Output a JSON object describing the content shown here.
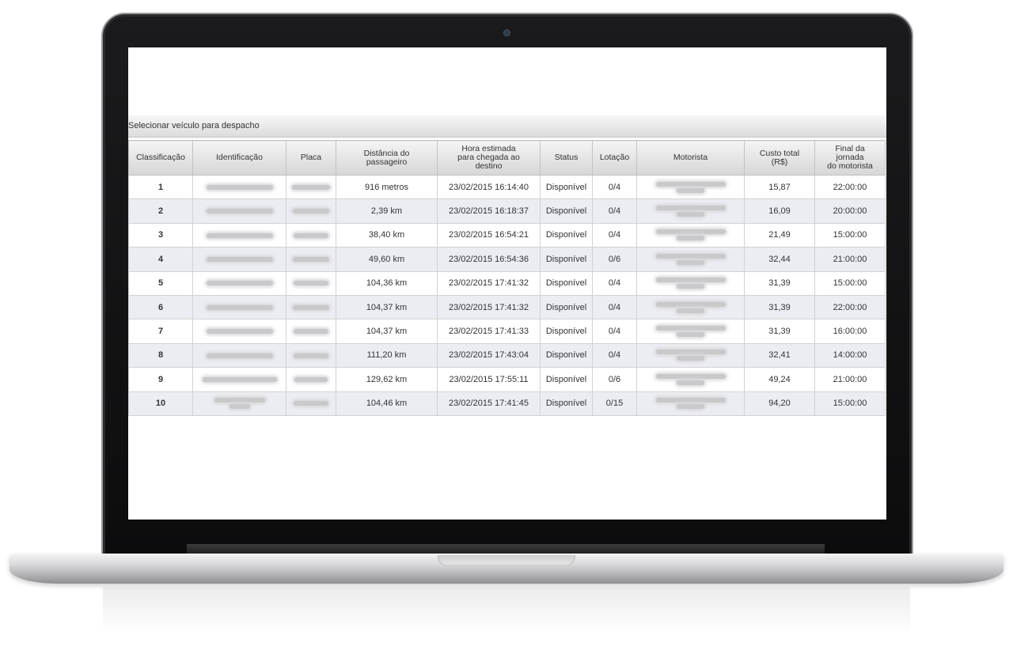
{
  "panel": {
    "title": "Selecionar veículo para despacho"
  },
  "table": {
    "headers": [
      "Classificação",
      "Identificação",
      "Placa",
      "Distância do\npassageiro",
      "Hora estimada\npara chegada ao\ndestino",
      "Status",
      "Lotação",
      "Motorista",
      "Custo total\n(R$)",
      "Final da\njornada\ndo motorista"
    ],
    "rows": [
      {
        "rank": "1",
        "distance": "916 metros",
        "eta": "23/02/2015 16:14:40",
        "status": "Disponível",
        "occupancy": "0/4",
        "cost": "15,87",
        "shift_end": "22:00:00"
      },
      {
        "rank": "2",
        "distance": "2,39 km",
        "eta": "23/02/2015 16:18:37",
        "status": "Disponível",
        "occupancy": "0/4",
        "cost": "16,09",
        "shift_end": "20:00:00"
      },
      {
        "rank": "3",
        "distance": "38,40 km",
        "eta": "23/02/2015 16:54:21",
        "status": "Disponível",
        "occupancy": "0/4",
        "cost": "21,49",
        "shift_end": "15:00:00"
      },
      {
        "rank": "4",
        "distance": "49,60 km",
        "eta": "23/02/2015 16:54:36",
        "status": "Disponível",
        "occupancy": "0/6",
        "cost": "32,44",
        "shift_end": "21:00:00"
      },
      {
        "rank": "5",
        "distance": "104,36 km",
        "eta": "23/02/2015 17:41:32",
        "status": "Disponível",
        "occupancy": "0/4",
        "cost": "31,39",
        "shift_end": "15:00:00"
      },
      {
        "rank": "6",
        "distance": "104,37 km",
        "eta": "23/02/2015 17:41:32",
        "status": "Disponível",
        "occupancy": "0/4",
        "cost": "31,39",
        "shift_end": "22:00:00"
      },
      {
        "rank": "7",
        "distance": "104,37 km",
        "eta": "23/02/2015 17:41:33",
        "status": "Disponível",
        "occupancy": "0/4",
        "cost": "31,39",
        "shift_end": "16:00:00"
      },
      {
        "rank": "8",
        "distance": "111,20 km",
        "eta": "23/02/2015 17:43:04",
        "status": "Disponível",
        "occupancy": "0/4",
        "cost": "32,41",
        "shift_end": "14:00:00"
      },
      {
        "rank": "9",
        "distance": "129,62 km",
        "eta": "23/02/2015 17:55:11",
        "status": "Disponível",
        "occupancy": "0/6",
        "cost": "49,24",
        "shift_end": "21:00:00"
      },
      {
        "rank": "10",
        "distance": "104,46 km",
        "eta": "23/02/2015 17:41:45",
        "status": "Disponível",
        "occupancy": "0/15",
        "cost": "94,20",
        "shift_end": "15:00:00"
      }
    ]
  },
  "colors": {
    "row_stripe": "#ecedf3",
    "header_gradient_top": "#f4f4f4",
    "header_gradient_bottom": "#d6d6d6"
  }
}
